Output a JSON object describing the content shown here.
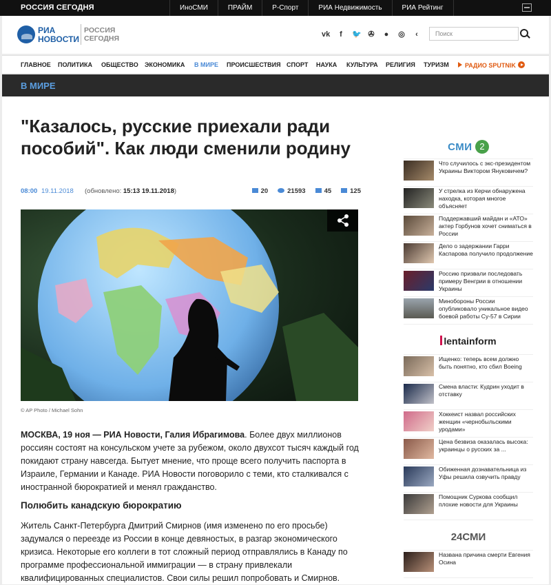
{
  "topbar": {
    "brand": "РОССИЯ СЕГОДНЯ",
    "links": [
      "ИноСМИ",
      "ПРАЙМ",
      "Р-Спорт",
      "РИА Недвижимость",
      "РИА Рейтинг"
    ]
  },
  "header": {
    "logo_ria": "РИА",
    "logo_novosti": "НОВОСТИ",
    "logo_rossiya": "РОССИЯ",
    "logo_segodnya": "СЕГОДНЯ",
    "social": [
      "vk",
      "f",
      "t",
      "ok",
      "oo",
      "ig",
      "share"
    ],
    "search_placeholder": "Поиск"
  },
  "nav": {
    "items": [
      "ГЛАВНОЕ",
      "ПОЛИТИКА",
      "ОБЩЕСТВО",
      "ЭКОНОМИКА",
      "В МИРЕ",
      "ПРОИСШЕСТВИЯ",
      "СПОРТ",
      "НАУКА",
      "КУЛЬТУРА",
      "РЕЛИГИЯ",
      "ТУРИЗМ"
    ],
    "radio": "РАДИО SPUTNIK"
  },
  "section_title": "В МИРЕ",
  "article": {
    "title": "\"Казалось, русские приехали ради пособий\". Как люди сменили родину",
    "time": "08:00",
    "date": "19.11.2018",
    "updated_prefix": "(обновлено: ",
    "updated": "15:13 19.11.2018",
    "updated_suffix": ")",
    "comments": "20",
    "views": "21593",
    "likes": "45",
    "dislikes": "125",
    "photo_credit": "© AP Photo / Michael Sohn",
    "lead_bold": "МОСКВА, 19 ноя — РИА Новости, Галия Ибрагимова",
    "lead_text": ". Более двух миллионов россиян состоят на консульском учете за рубежом, около двухсот тысяч каждый год покидают страну навсегда. Бытует мнение, что проще всего получить паспорта в Израиле, Германии и Канаде. РИА Новости поговорило с теми, кто сталкивался с иностранной бюрократией и менял гражданство.",
    "subhead": "Полюбить канадскую бюрократию",
    "para": "Житель Санкт-Петербурга Дмитрий Смирнов (имя изменено по его просьбе) задумался о переезде из России в конце девяностых, в разгар экономического кризиса. Некоторые его коллеги в тот сложный период отправлялись в Канаду по программе профессиональной иммиграции — в страну привлекали квалифицированных специалистов. Свои силы решил попробовать и Смирнов."
  },
  "sidebar": {
    "smi2_label": "СМИ",
    "smi2_num": "2",
    "smi2_news": [
      "Что случилось с экс-президентом Украины Виктором Януковичем?",
      "У стрелка из Керчи обнаружена находка, которая многое объясняет",
      "Поддержавший майдан и «АТО» актер Горбунов хочет сниматься в России",
      "Дело о задержании Гарри Каспарова получило продолжение",
      "Россию призвали последовать примеру Венгрии в отношении Украины",
      "Минобороны России опубликовало уникальное видео боевой работы Су-57 в Сирии"
    ],
    "lenta_label": "lentainform",
    "lenta_news": [
      "Ищенко: теперь всем должно быть понятно, кто сбил Boeing",
      "Смена власти: Кудрин уходит в отставку",
      "Хоккеист назвал российских женщин «чернобыльскими уродами»",
      "Цена безвиза оказалась высока: украинцы о русских за ...",
      "Обиженная дознавательница из Уфы решила озвучить правду",
      "Помощник Суркова сообщил плохие новости для Украины"
    ],
    "c24_label": "24СМИ",
    "c24_news": [
      "Названа причина смерти Евгения Осина"
    ]
  }
}
